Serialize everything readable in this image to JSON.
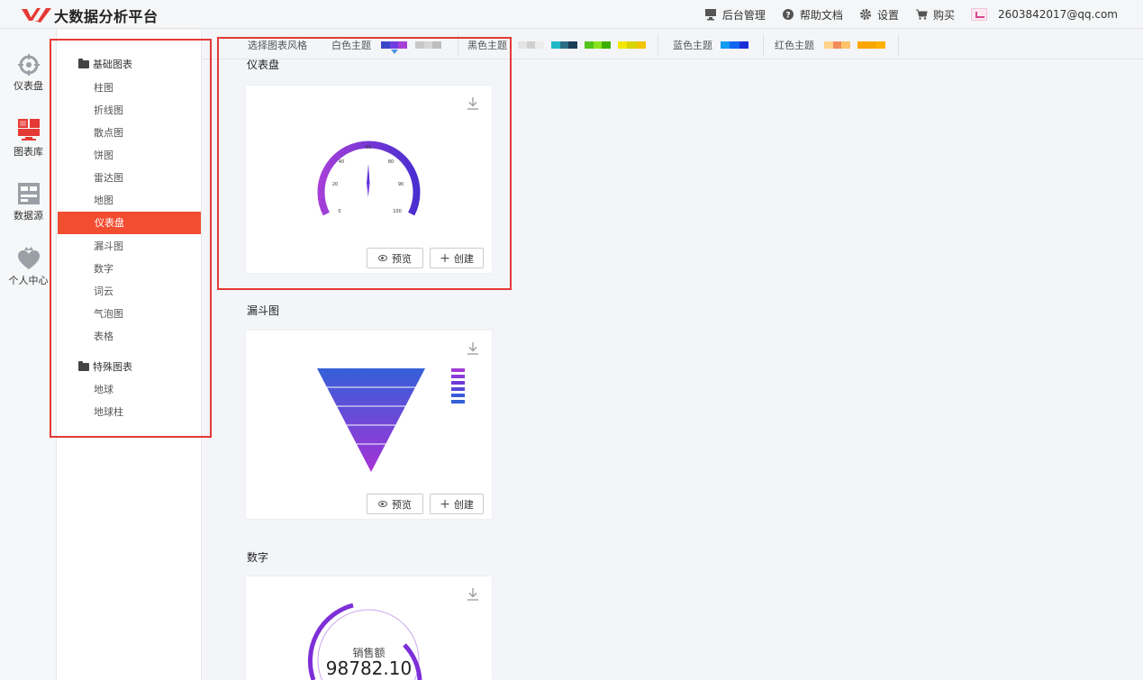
{
  "app": {
    "title": "大数据分析平台"
  },
  "topnav": {
    "admin": "后台管理",
    "help": "帮助文档",
    "settings": "设置",
    "buy": "购买",
    "user": "2603842017@qq.com"
  },
  "iconnav": [
    {
      "label": "仪表盘",
      "icon": "dashboard-icon"
    },
    {
      "label": "图表库",
      "icon": "chart-library-icon"
    },
    {
      "label": "数据源",
      "icon": "datasource-icon"
    },
    {
      "label": "个人中心",
      "icon": "user-center-icon"
    }
  ],
  "sidebar": {
    "group1": "基础图表",
    "items1": [
      "柱图",
      "折线图",
      "散点图",
      "饼图",
      "雷达图",
      "地图",
      "仪表盘",
      "漏斗图",
      "数字",
      "词云",
      "气泡图",
      "表格"
    ],
    "active": "仪表盘",
    "group2": "特殊图表",
    "items2": [
      "地球",
      "地球柱"
    ]
  },
  "themes": {
    "label": "选择图表风格",
    "white": "白色主题",
    "black": "黑色主题",
    "blue": "蓝色主题",
    "red": "红色主题"
  },
  "colors": {
    "accent": "#f24d31",
    "highlight_box": "#e53935",
    "gauge_start": "#a43fd8",
    "gauge_end": "#4a2fd0",
    "funnel_top": "#3560d8",
    "funnel_bottom": "#a532d6"
  },
  "sections": {
    "gauge": "仪表盘",
    "funnel": "漏斗图",
    "number": "数字"
  },
  "buttons": {
    "preview": "预览",
    "create": "创建"
  },
  "gauge": {
    "ticks": [
      "0",
      "20",
      "40",
      "60",
      "80",
      "90",
      "100"
    ]
  },
  "number_card": {
    "label": "销售额",
    "value": "98782.10"
  }
}
